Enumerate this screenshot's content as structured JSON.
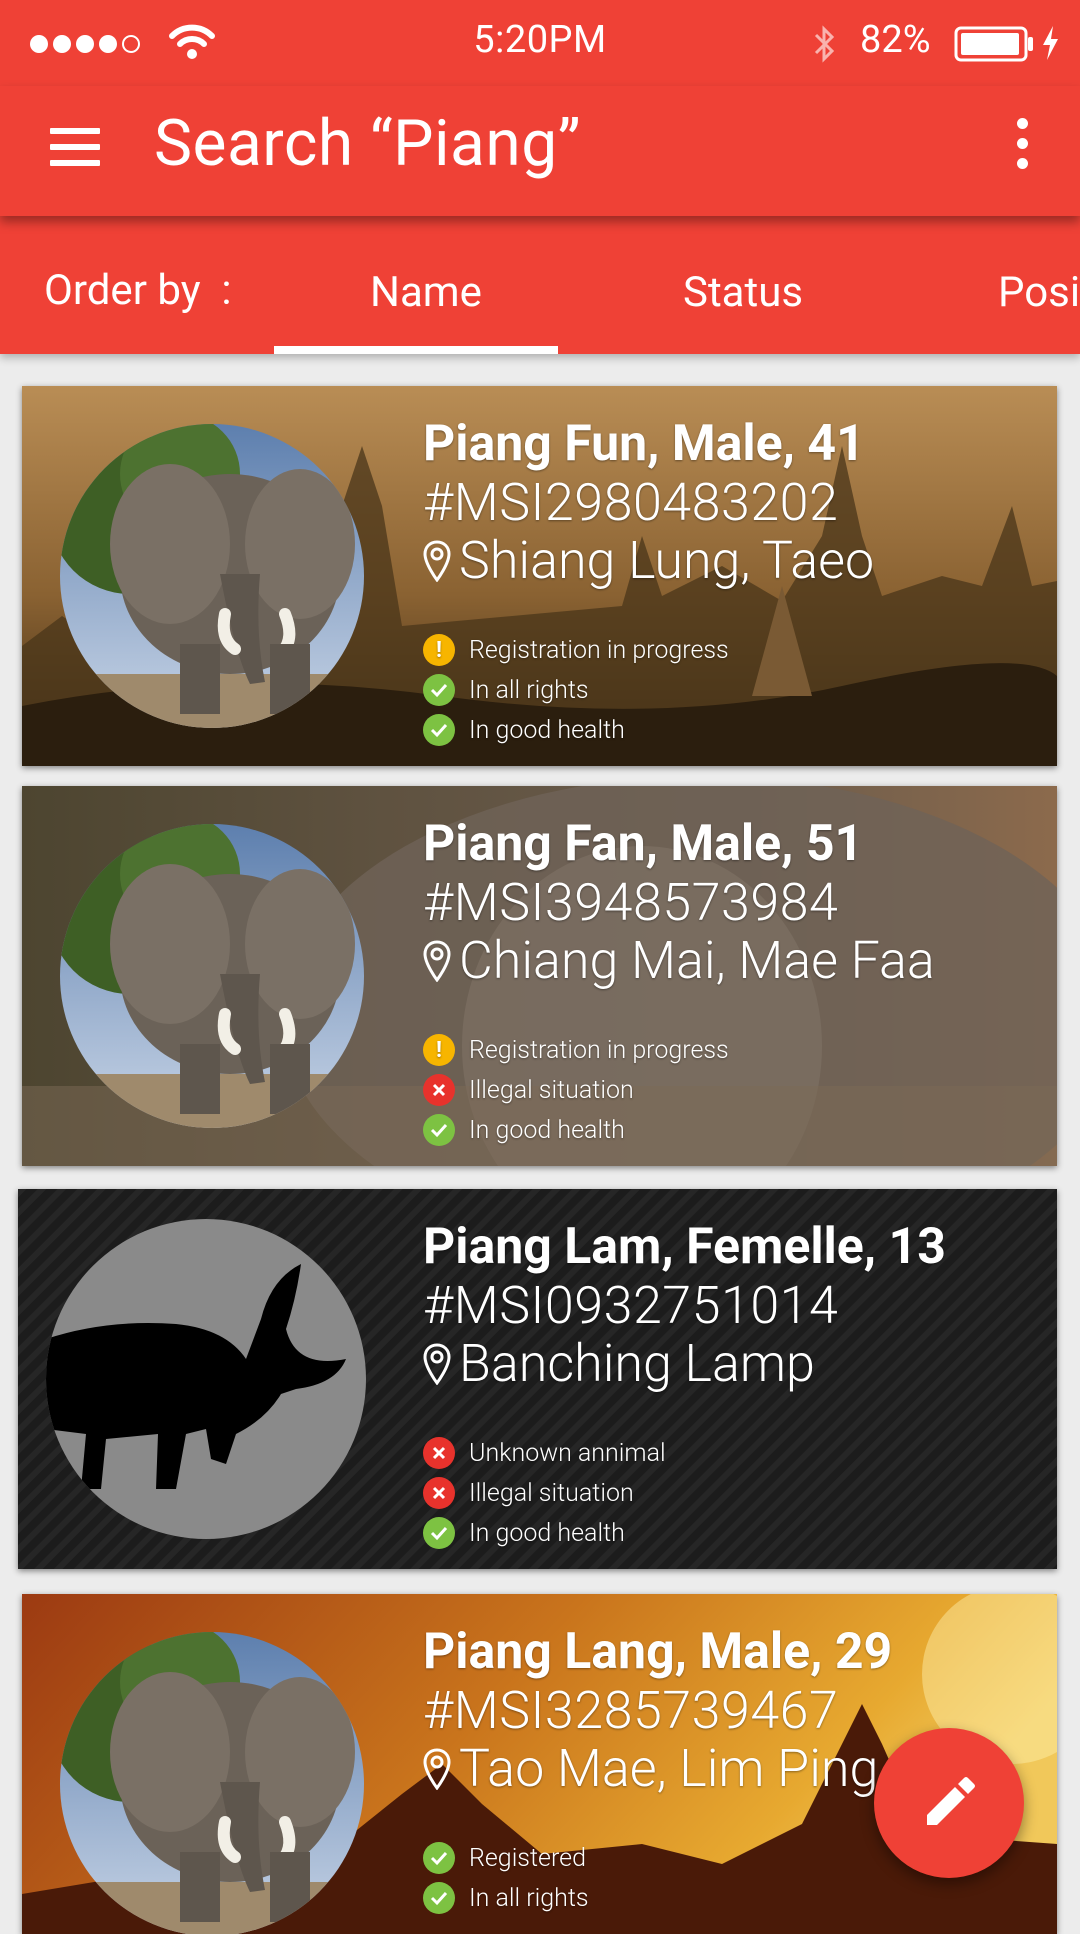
{
  "status_bar": {
    "time": "5:20PM",
    "battery": "82%"
  },
  "app_bar": {
    "title": "Search “Piang”"
  },
  "order_by": {
    "label": "Order by  :",
    "tabs": [
      {
        "label": "Name",
        "selected": true
      },
      {
        "label": "Status"
      },
      {
        "label": "Posi"
      }
    ]
  },
  "elephants": [
    {
      "name": "Piang Fun, Male, 41",
      "id": "#MSI2980483202",
      "location": "Shiang Lung, Taeo",
      "statuses": [
        {
          "type": "warning",
          "text": "Registration in progress"
        },
        {
          "type": "ok",
          "text": "In all rights"
        },
        {
          "type": "ok",
          "text": "In good health"
        }
      ]
    },
    {
      "name": "Piang Fan, Male, 51",
      "id": "#MSI3948573984",
      "location": "Chiang Mai, Mae Faa",
      "statuses": [
        {
          "type": "warning",
          "text": "Registration in progress"
        },
        {
          "type": "error",
          "text": "Illegal situation"
        },
        {
          "type": "ok",
          "text": "In good health"
        }
      ]
    },
    {
      "name": "Piang Lam, Femelle, 13",
      "id": "#MSI0932751014",
      "location": "Banching Lamp",
      "statuses": [
        {
          "type": "error",
          "text": "Unknown annimal"
        },
        {
          "type": "error",
          "text": "Illegal situation"
        },
        {
          "type": "ok",
          "text": "In good health"
        }
      ]
    },
    {
      "name": "Piang Lang, Male, 29",
      "id": "#MSI3285739467",
      "location": "Tao Mae, Lim Ping",
      "statuses": [
        {
          "type": "ok",
          "text": "Registered"
        },
        {
          "type": "ok",
          "text": "In all rights"
        }
      ]
    }
  ],
  "colors": {
    "primary": "#ef4136",
    "ok": "#7dc242",
    "warning": "#f7b500",
    "error": "#e8322c"
  },
  "icons": {
    "menu": "menu-icon",
    "more": "more-vert-icon",
    "pin": "location-pin-icon",
    "fab": "edit-pencil-icon"
  }
}
